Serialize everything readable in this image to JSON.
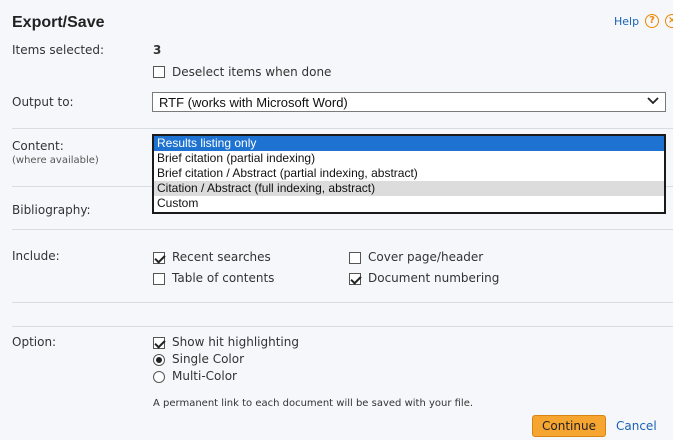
{
  "header": {
    "title": "Export/Save",
    "help_label": "Help"
  },
  "items_selected": {
    "label": "Items selected:",
    "count": "3",
    "deselect_label": "Deselect items when done",
    "deselect_checked": false
  },
  "output": {
    "label": "Output to:",
    "selected": "RTF (works with Microsoft Word)"
  },
  "content": {
    "label": "Content:",
    "sublabel": "(where available)",
    "options": [
      "Results listing only",
      "Brief citation (partial indexing)",
      "Brief citation / Abstract (partial indexing, abstract)",
      "Citation / Abstract (full indexing, abstract)",
      "Custom"
    ],
    "selected_index": 0,
    "hover_index": 3
  },
  "bibliography": {
    "label": "Bibliography:"
  },
  "include": {
    "label": "Include:",
    "recent_searches": "Recent searches",
    "table_of_contents": "Table of contents",
    "cover_page": "Cover page/header",
    "document_numbering": "Document numbering",
    "recent_searches_checked": true,
    "table_of_contents_checked": false,
    "cover_page_checked": false,
    "document_numbering_checked": true
  },
  "option": {
    "label": "Option:",
    "show_hit_highlighting": "Show hit highlighting",
    "single_color": "Single Color",
    "multi_color": "Multi-Color",
    "show_hit_highlighting_checked": true,
    "selected_color_mode": "Single Color"
  },
  "footer": {
    "note": "A permanent link to each document will be saved with your file.",
    "continue_label": "Continue",
    "cancel_label": "Cancel"
  },
  "colors": {
    "accent_orange": "#f7a531",
    "link_blue": "#1a62b5",
    "selection_blue": "#1e73d2"
  }
}
